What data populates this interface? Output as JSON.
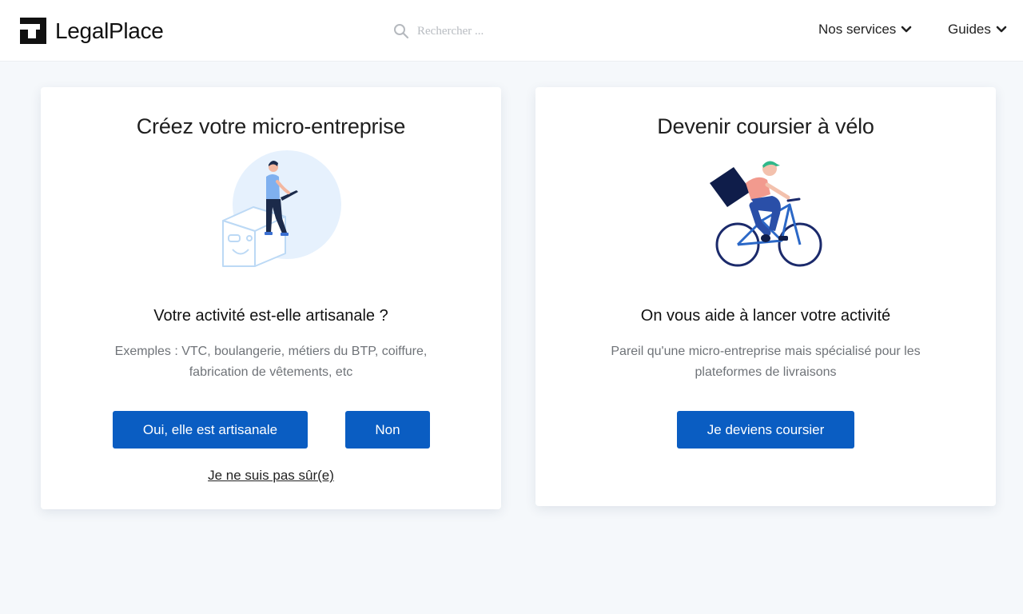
{
  "header": {
    "logo_text": "LegalPlace",
    "search_placeholder": "Rechercher ...",
    "nav": [
      {
        "label": "Nos services"
      },
      {
        "label": "Guides"
      }
    ]
  },
  "cards": [
    {
      "title": "Créez votre micro-entreprise",
      "subtitle": "Votre activité est-elle artisanale ?",
      "description": "Exemples : VTC, boulangerie, métiers du BTP, coiffure, fabrication de vêtements, etc",
      "buttons": [
        {
          "label": "Oui, elle est artisanale"
        },
        {
          "label": "Non"
        }
      ],
      "link": "Je ne suis pas sûr(e)"
    },
    {
      "title": "Devenir coursier à vélo",
      "subtitle": "On vous aide à lancer votre activité",
      "description": "Pareil qu'une micro-entreprise mais spécialisé pour les plateformes de livraisons",
      "buttons": [
        {
          "label": "Je deviens coursier"
        }
      ]
    }
  ],
  "colors": {
    "primary_button": "#0a5dc2",
    "background": "#f5f8fb"
  },
  "icons": [
    "logo-icon",
    "search-icon",
    "chevron-down-icon",
    "chevron-down-icon"
  ]
}
